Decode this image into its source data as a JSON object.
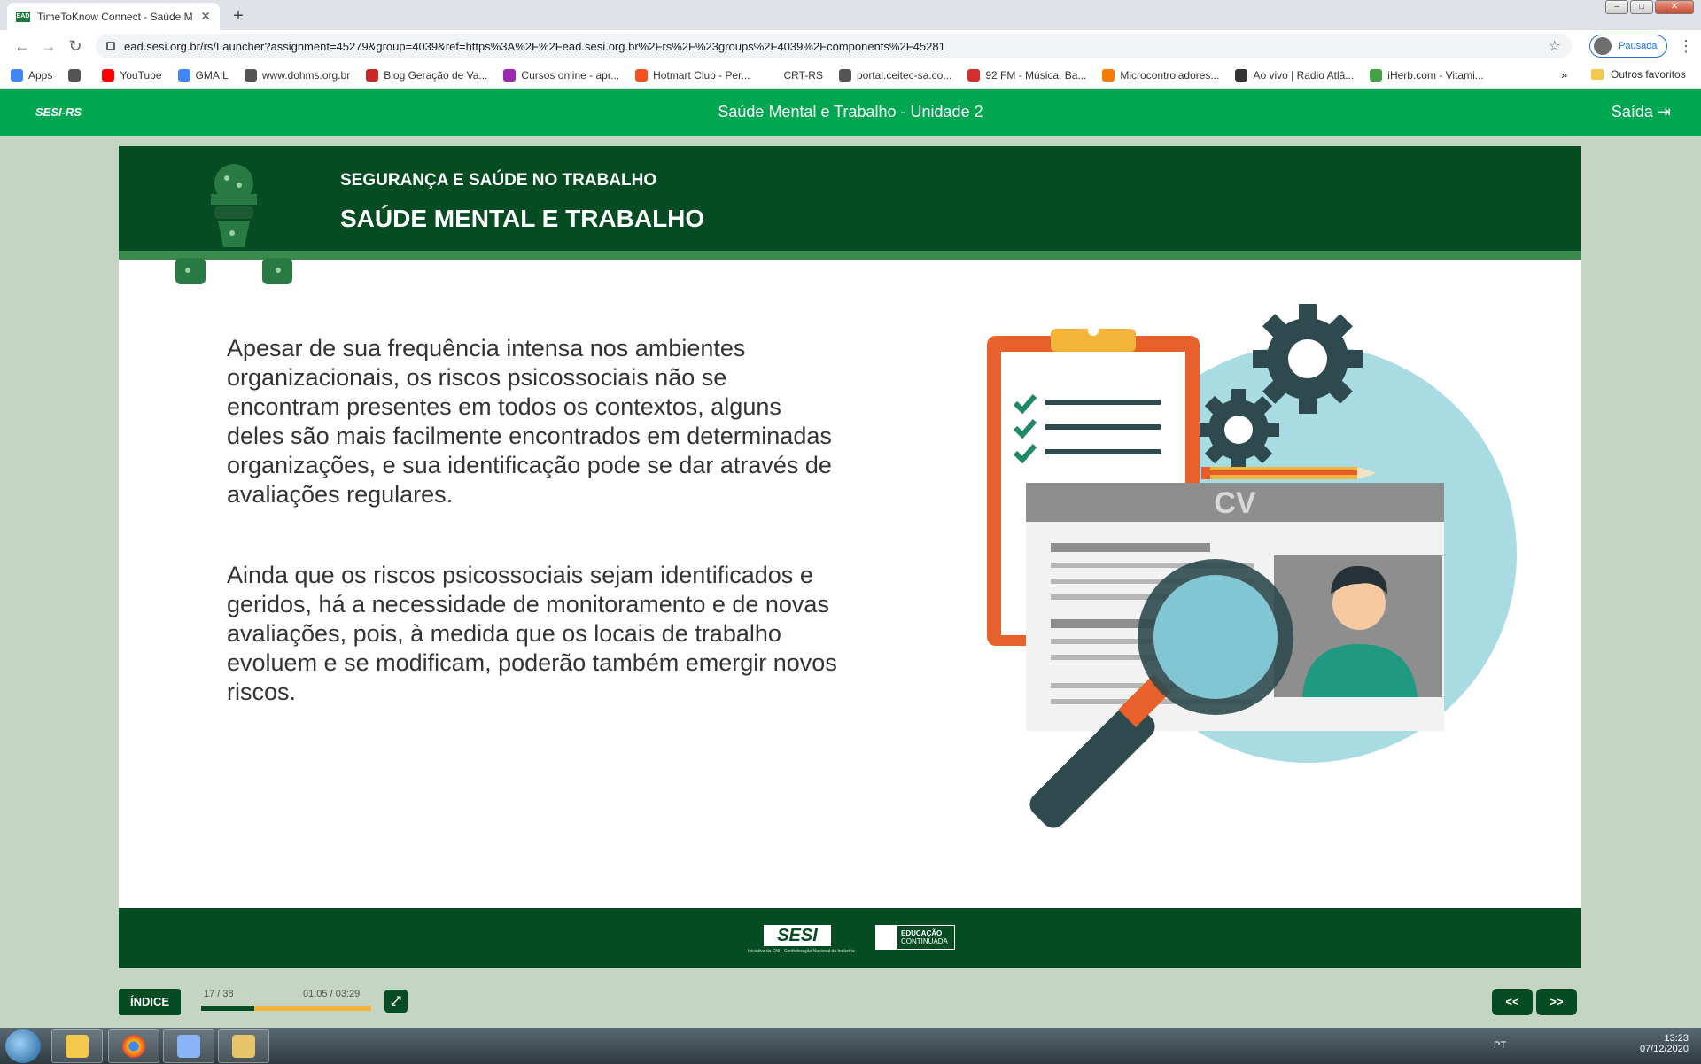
{
  "browser": {
    "tab_title": "TimeToKnow Connect - Saúde M",
    "tab_favicon": "EAD",
    "url": "ead.sesi.org.br/rs/Launcher?assignment=45279&group=4039&ref=https%3A%2F%2Fead.sesi.org.br%2Frs%2F%23groups%2F4039%2Fcomponents%2F45281",
    "profile_label": "Pausada",
    "bookmarks": [
      {
        "label": "Apps",
        "color": "#4285f4"
      },
      {
        "label": "",
        "color": "#555555"
      },
      {
        "label": "YouTube",
        "color": "#ff0000"
      },
      {
        "label": "GMAIL",
        "color": "#4285f4"
      },
      {
        "label": "www.dohms.org.br",
        "color": "#555555"
      },
      {
        "label": "Blog Geração de Va...",
        "color": "#c62828"
      },
      {
        "label": "Cursos online - apr...",
        "color": "#9c27b0"
      },
      {
        "label": "Hotmart Club - Per...",
        "color": "#f4511e"
      },
      {
        "label": "CRT-RS",
        "color": "#ffffff"
      },
      {
        "label": "portal.ceitec-sa.co...",
        "color": "#555555"
      },
      {
        "label": "92 FM - Música, Ba...",
        "color": "#d32f2f"
      },
      {
        "label": "Microcontroladores...",
        "color": "#f57c00"
      },
      {
        "label": "Ao vivo | Radio Atlâ...",
        "color": "#333333"
      },
      {
        "label": "iHerb.com - Vitami...",
        "color": "#43a047"
      }
    ],
    "bookmarks_more": "»",
    "other_bookmarks": "Outros favoritos"
  },
  "app": {
    "logo": "SESI-RS",
    "title": "Saúde Mental e Trabalho - Unidade 2",
    "exit_label": "Saída"
  },
  "lesson": {
    "kicker": "SEGURANÇA E SAÚDE NO TRABALHO",
    "heading": "SAÚDE MENTAL E TRABALHO",
    "paragraph_1": "Apesar de sua frequência intensa nos ambientes organizacionais, os riscos psicossociais não se encontram presentes em todos os contextos, alguns deles são mais facilmente encontrados em determinadas organizações, e sua identificação pode se dar através de avaliações regulares.",
    "paragraph_2": "Ainda que os riscos psicossociais sejam identificados e geridos, há a necessidade de monitoramento e de novas avaliações, pois, à medida que os locais de trabalho evoluem e se modificam, poderão também emergir novos riscos.",
    "illustration_label": "CV"
  },
  "footer": {
    "sesi_logo": "SESI",
    "sesi_sub": "Iniciativa da CNI - Confederação Nacional da Indústria",
    "edu_logo_line1": "EDUCAÇÃO",
    "edu_logo_line2": "CONTINUADA"
  },
  "player": {
    "index_label": "ÍNDICE",
    "page_counter": "17 / 38",
    "time_counter": "01:05 / 03:29",
    "progress_fraction": 0.31,
    "prev_label": "<<",
    "next_label": ">>"
  },
  "taskbar": {
    "lang": "PT",
    "time": "13:23",
    "date": "07/12/2020"
  },
  "colors": {
    "header_green": "#00a650",
    "banner_green": "#064c23",
    "progress_orange": "#f4b43a"
  }
}
